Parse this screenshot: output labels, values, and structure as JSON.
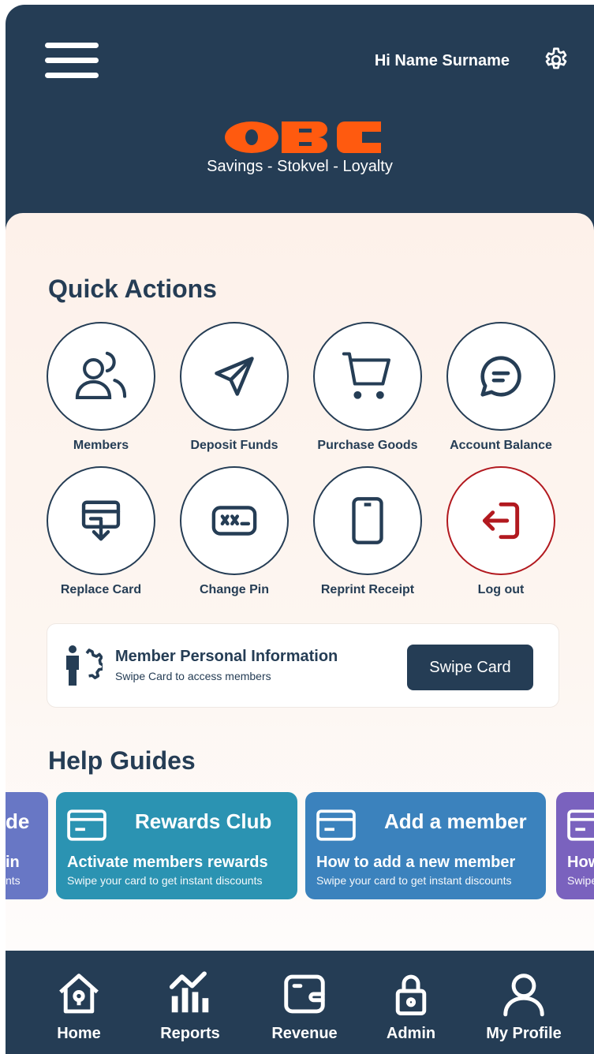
{
  "header": {
    "greeting": "Hi Name Surname",
    "brand_tagline": "Savings - Stokvel - Loyalty",
    "menu_icon": "hamburger-menu-icon",
    "settings_icon": "gear-icon"
  },
  "brand": {
    "logo_text": "OBC",
    "logo_color": "#ff5a0f"
  },
  "quick_actions": {
    "title": "Quick Actions",
    "items": [
      {
        "label": "Members",
        "icon": "members-icon"
      },
      {
        "label": "Deposit Funds",
        "icon": "paper-plane-icon"
      },
      {
        "label": "Purchase Goods",
        "icon": "shopping-cart-icon"
      },
      {
        "label": "Account Balance",
        "icon": "chat-bubble-icon"
      },
      {
        "label": "Replace Card",
        "icon": "card-download-icon"
      },
      {
        "label": "Change Pin",
        "icon": "pin-code-icon"
      },
      {
        "label": "Reprint Receipt",
        "icon": "phone-icon"
      },
      {
        "label": "Log out",
        "icon": "logout-icon",
        "color": "#b2191f"
      }
    ]
  },
  "member_info": {
    "title": "Member Personal Information",
    "subtitle": "Swipe Card to access members",
    "button": "Swipe Card",
    "icon": "member-gear-icon"
  },
  "help_guides": {
    "title": "Help Guides",
    "cards": [
      {
        "title": "de",
        "heading": "in",
        "subtitle": "nts",
        "color": "#6877c5"
      },
      {
        "title": "Rewards Club",
        "heading": "Activate members rewards",
        "subtitle": "Swipe your card to get instant discounts",
        "color": "#2b93b2"
      },
      {
        "title": "Add a member",
        "heading": "How to add a new member",
        "subtitle": "Swipe your card to get instant discounts",
        "color": "#3b82bd"
      },
      {
        "title": "",
        "heading": "How",
        "subtitle": "Swipe",
        "color": "#7a62be"
      }
    ]
  },
  "bottom_nav": [
    {
      "label": "Home",
      "icon": "home-icon"
    },
    {
      "label": "Reports",
      "icon": "reports-chart-icon"
    },
    {
      "label": "Revenue",
      "icon": "wallet-icon"
    },
    {
      "label": "Admin",
      "icon": "lock-icon"
    },
    {
      "label": "My Profile",
      "icon": "profile-icon"
    }
  ]
}
